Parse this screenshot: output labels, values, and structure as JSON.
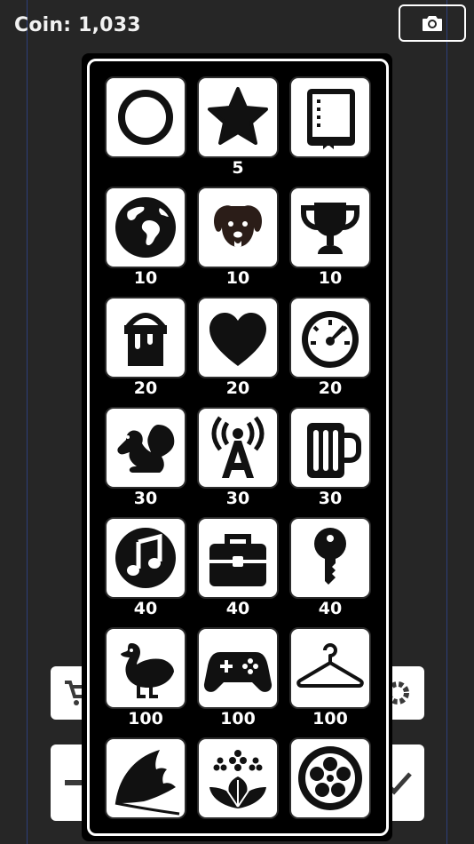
{
  "header": {
    "coin_text": "Coin: 1,033"
  },
  "toolbar": {
    "camera_icon": "camera-icon"
  },
  "background_buttons": [
    {
      "icon": "cart-icon"
    },
    {
      "icon": "gear-icon"
    },
    {
      "icon": "minus-icon"
    },
    {
      "icon": "check-icon"
    }
  ],
  "shop": {
    "items": [
      {
        "icon": "circle-icon",
        "price": ""
      },
      {
        "icon": "star-icon",
        "price": "5"
      },
      {
        "icon": "book-icon",
        "price": ""
      },
      {
        "icon": "globe-icon",
        "price": "10"
      },
      {
        "icon": "dog-icon",
        "price": "10"
      },
      {
        "icon": "trophy-icon",
        "price": "10"
      },
      {
        "icon": "paint-bucket-icon",
        "price": "20"
      },
      {
        "icon": "heart-icon",
        "price": "20"
      },
      {
        "icon": "speedometer-icon",
        "price": "20"
      },
      {
        "icon": "squirrel-icon",
        "price": "30"
      },
      {
        "icon": "broadcast-tower-icon",
        "price": "30"
      },
      {
        "icon": "beer-mug-icon",
        "price": "30"
      },
      {
        "icon": "music-note-icon",
        "price": "40"
      },
      {
        "icon": "toolbox-icon",
        "price": "40"
      },
      {
        "icon": "key-icon",
        "price": "40"
      },
      {
        "icon": "duck-icon",
        "price": "100"
      },
      {
        "icon": "gamepad-icon",
        "price": "100"
      },
      {
        "icon": "hanger-icon",
        "price": "100"
      },
      {
        "icon": "ginkgo-leaf-icon",
        "price": ""
      },
      {
        "icon": "paulownia-crest-icon",
        "price": ""
      },
      {
        "icon": "flower-crest-icon",
        "price": ""
      }
    ]
  }
}
